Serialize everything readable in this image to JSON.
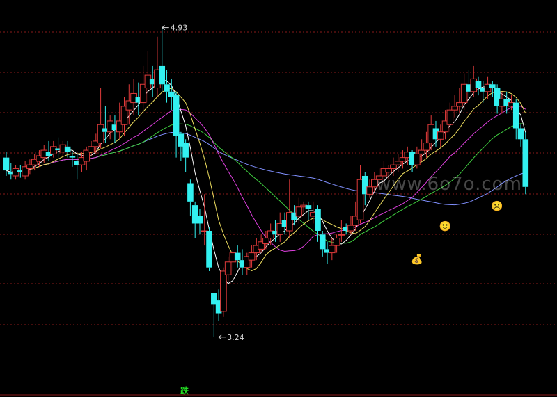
{
  "chart_data": {
    "type": "candlestick",
    "title": "",
    "y_range": [
      3.0,
      5.05
    ],
    "max_marker": {
      "index": 33,
      "value": 4.93,
      "label": "4.93"
    },
    "min_marker": {
      "index": 45,
      "value": 3.24,
      "label": "3.24"
    },
    "signal_label": "跌",
    "watermark": "www.6o7o.com",
    "colors": {
      "up": "#e03a3a",
      "down": "#32f0f0",
      "grid": "#8a1a1a",
      "ma5": "#ffffff",
      "ma10": "#f0e060",
      "ma20": "#e040e0",
      "ma30": "#40d040",
      "ma60": "#8090ff"
    },
    "candles": [
      [
        4.22,
        4.15,
        4.25,
        4.12
      ],
      [
        4.14,
        4.13,
        4.19,
        4.1
      ],
      [
        4.12,
        4.16,
        4.18,
        4.1
      ],
      [
        4.15,
        4.14,
        4.18,
        4.11
      ],
      [
        4.12,
        4.17,
        4.2,
        4.1
      ],
      [
        4.16,
        4.18,
        4.21,
        4.13
      ],
      [
        4.18,
        4.21,
        4.24,
        4.15
      ],
      [
        4.2,
        4.23,
        4.26,
        4.17
      ],
      [
        4.22,
        4.26,
        4.29,
        4.19
      ],
      [
        4.25,
        4.23,
        4.31,
        4.2
      ],
      [
        4.24,
        4.28,
        4.31,
        4.22
      ],
      [
        4.27,
        4.26,
        4.33,
        4.22
      ],
      [
        4.25,
        4.29,
        4.31,
        4.22
      ],
      [
        4.28,
        4.25,
        4.31,
        4.22
      ],
      [
        4.23,
        4.22,
        4.25,
        4.17
      ],
      [
        4.2,
        4.18,
        4.24,
        4.1
      ],
      [
        4.18,
        4.22,
        4.25,
        4.14
      ],
      [
        4.2,
        4.26,
        4.28,
        4.15
      ],
      [
        4.25,
        4.28,
        4.31,
        4.23
      ],
      [
        4.28,
        4.31,
        4.35,
        4.24
      ],
      [
        4.3,
        4.4,
        4.6,
        4.27
      ],
      [
        4.38,
        4.36,
        4.5,
        4.3
      ],
      [
        4.36,
        4.42,
        4.45,
        4.32
      ],
      [
        4.4,
        4.37,
        4.45,
        4.3
      ],
      [
        4.36,
        4.42,
        4.52,
        4.32
      ],
      [
        4.4,
        4.5,
        4.55,
        4.34
      ],
      [
        4.48,
        4.53,
        4.62,
        4.4
      ],
      [
        4.52,
        4.57,
        4.65,
        4.45
      ],
      [
        4.55,
        4.52,
        4.63,
        4.45
      ],
      [
        4.52,
        4.62,
        4.72,
        4.48
      ],
      [
        4.6,
        4.67,
        4.8,
        4.52
      ],
      [
        4.65,
        4.62,
        4.72,
        4.55
      ],
      [
        4.6,
        4.7,
        4.88,
        4.55
      ],
      [
        4.72,
        4.62,
        4.93,
        4.58
      ],
      [
        4.62,
        4.58,
        4.7,
        4.52
      ],
      [
        4.58,
        4.55,
        4.65,
        4.48
      ],
      [
        4.56,
        4.34,
        4.58,
        4.22
      ],
      [
        4.35,
        4.28,
        4.36,
        4.2
      ],
      [
        4.3,
        4.22,
        4.32,
        4.14
      ],
      [
        4.08,
        3.98,
        4.1,
        3.9
      ],
      [
        3.96,
        3.86,
        3.98,
        3.78
      ],
      [
        3.9,
        3.86,
        3.94,
        3.8
      ],
      [
        3.82,
        3.82,
        4.02,
        3.74
      ],
      [
        3.82,
        3.62,
        3.84,
        3.6
      ],
      [
        3.48,
        3.42,
        3.48,
        3.24
      ],
      [
        3.44,
        3.37,
        3.5,
        3.33
      ],
      [
        3.38,
        3.6,
        3.62,
        3.35
      ],
      [
        3.58,
        3.65,
        3.68,
        3.54
      ],
      [
        3.65,
        3.7,
        3.72,
        3.6
      ],
      [
        3.7,
        3.66,
        3.74,
        3.62
      ],
      [
        3.66,
        3.62,
        3.72,
        3.58
      ],
      [
        3.62,
        3.68,
        3.7,
        3.58
      ],
      [
        3.66,
        3.7,
        3.74,
        3.62
      ],
      [
        3.7,
        3.74,
        3.78,
        3.66
      ],
      [
        3.72,
        3.76,
        3.8,
        3.7
      ],
      [
        3.75,
        3.78,
        3.82,
        3.72
      ],
      [
        3.78,
        3.82,
        3.86,
        3.74
      ],
      [
        3.82,
        3.8,
        3.88,
        3.76
      ],
      [
        3.8,
        3.86,
        3.92,
        3.76
      ],
      [
        3.88,
        3.84,
        3.92,
        3.8
      ],
      [
        3.82,
        3.92,
        4.1,
        3.78
      ],
      [
        3.92,
        3.88,
        3.96,
        3.85
      ],
      [
        3.9,
        3.95,
        4.0,
        3.86
      ],
      [
        3.95,
        3.96,
        3.98,
        3.92
      ],
      [
        3.96,
        3.94,
        3.98,
        3.88
      ],
      [
        3.9,
        3.92,
        3.98,
        3.86
      ],
      [
        3.94,
        3.82,
        3.96,
        3.76
      ],
      [
        3.8,
        3.72,
        3.82,
        3.68
      ],
      [
        3.72,
        3.7,
        3.76,
        3.64
      ],
      [
        3.7,
        3.74,
        3.78,
        3.66
      ],
      [
        3.74,
        3.78,
        3.8,
        3.7
      ],
      [
        3.8,
        3.8,
        3.88,
        3.76
      ],
      [
        3.84,
        3.82,
        3.86,
        3.8
      ],
      [
        3.82,
        3.85,
        3.9,
        3.8
      ],
      [
        3.85,
        3.9,
        3.98,
        3.82
      ],
      [
        3.88,
        4.1,
        4.18,
        3.86
      ],
      [
        4.12,
        4.02,
        4.14,
        3.96
      ],
      [
        4.02,
        4.06,
        4.1,
        4.0
      ],
      [
        4.06,
        4.1,
        4.14,
        4.03
      ],
      [
        4.1,
        4.12,
        4.16,
        4.06
      ],
      [
        4.12,
        4.16,
        4.2,
        4.08
      ],
      [
        4.14,
        4.16,
        4.18,
        4.1
      ],
      [
        4.16,
        4.18,
        4.22,
        4.12
      ],
      [
        4.18,
        4.2,
        4.24,
        4.14
      ],
      [
        4.2,
        4.22,
        4.26,
        4.16
      ],
      [
        4.22,
        4.25,
        4.28,
        4.18
      ],
      [
        4.25,
        4.18,
        4.26,
        4.14
      ],
      [
        4.18,
        4.24,
        4.28,
        4.16
      ],
      [
        4.24,
        4.26,
        4.32,
        4.2
      ],
      [
        4.26,
        4.3,
        4.36,
        4.22
      ],
      [
        4.3,
        4.4,
        4.45,
        4.26
      ],
      [
        4.38,
        4.32,
        4.42,
        4.28
      ],
      [
        4.32,
        4.36,
        4.4,
        4.28
      ],
      [
        4.36,
        4.42,
        4.48,
        4.32
      ],
      [
        4.4,
        4.48,
        4.52,
        4.36
      ],
      [
        4.48,
        4.5,
        4.56,
        4.44
      ],
      [
        4.5,
        4.52,
        4.6,
        4.46
      ],
      [
        4.52,
        4.62,
        4.68,
        4.48
      ],
      [
        4.62,
        4.58,
        4.7,
        4.54
      ],
      [
        4.58,
        4.65,
        4.72,
        4.55
      ],
      [
        4.64,
        4.6,
        4.66,
        4.56
      ],
      [
        4.6,
        4.58,
        4.64,
        4.52
      ],
      [
        4.58,
        4.62,
        4.66,
        4.54
      ],
      [
        4.62,
        4.6,
        4.64,
        4.55
      ],
      [
        4.6,
        4.5,
        4.62,
        4.46
      ],
      [
        4.5,
        4.54,
        4.58,
        4.46
      ],
      [
        4.54,
        4.5,
        4.58,
        4.46
      ],
      [
        4.5,
        4.52,
        4.56,
        4.48
      ],
      [
        4.52,
        4.38,
        4.54,
        4.32
      ],
      [
        4.38,
        4.32,
        4.4,
        4.28
      ],
      [
        4.32,
        4.06,
        4.36,
        4.02
      ]
    ],
    "icons": [
      {
        "index": 87,
        "value": 3.67,
        "name": "money-bag-icon",
        "glyph": "💰"
      },
      {
        "index": 93,
        "value": 3.85,
        "name": "smile-icon",
        "glyph": "🙂"
      },
      {
        "index": 104,
        "value": 3.96,
        "name": "frown-icon",
        "glyph": "☹️"
      },
      {
        "index": 113,
        "value": 3.96,
        "name": "sad-face-icon",
        "glyph": "😟"
      }
    ]
  }
}
